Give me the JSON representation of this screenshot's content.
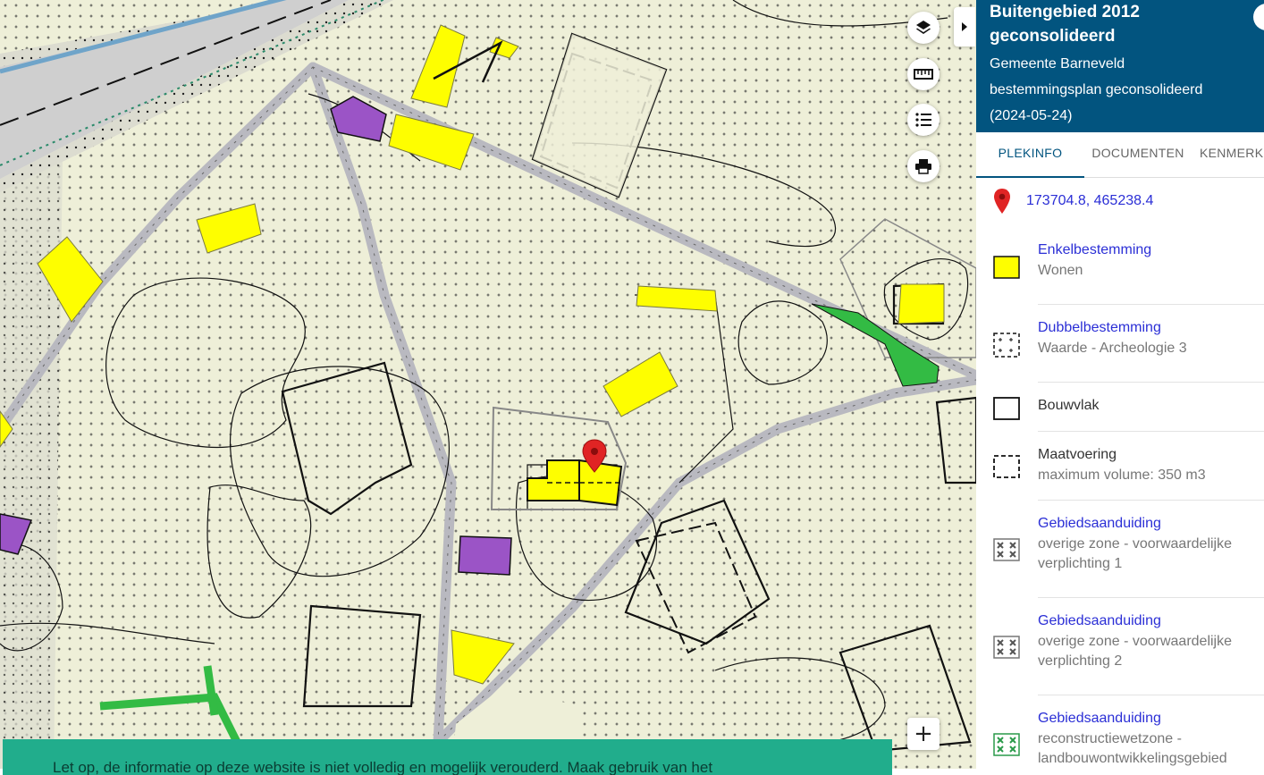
{
  "map": {
    "marker_icon": "map-marker-icon",
    "controls": [
      {
        "name": "layers",
        "icon": "layers-icon"
      },
      {
        "name": "measure",
        "icon": "ruler-icon"
      },
      {
        "name": "legend",
        "icon": "list-icon"
      },
      {
        "name": "print",
        "icon": "printer-icon"
      }
    ],
    "zoom_in_label": "+",
    "collapse_icon": "caret-right-icon"
  },
  "banner": {
    "text": "Let op, de informatie op deze website is niet volledig en mogelijk verouderd. Maak gebruik van het"
  },
  "panel": {
    "title": "Buitengebied 2012 geconsolideerd",
    "subtitle": "Gemeente Barneveld bestemmingsplan geconsolideerd (2024-05-24)",
    "header_color": "#02547f",
    "tabs": [
      {
        "label": "PLEKINFO",
        "active": true
      },
      {
        "label": "DOCUMENTEN",
        "active": false
      },
      {
        "label": "KENMERKEN",
        "active": false
      }
    ],
    "coordinates": "173704.8, 465238.4",
    "coordinates_icon": "map-pin-icon",
    "legend": [
      {
        "title": "Enkelbestemming",
        "desc": "Wonen",
        "symbol": "yellow-fill-icon"
      },
      {
        "title": "Dubbelbestemming",
        "desc": "Waarde - Archeologie 3",
        "symbol": "archeology-pattern-icon"
      },
      {
        "title": "Bouwvlak",
        "desc": "",
        "symbol": "solid-outline-icon"
      },
      {
        "title": "Maatvoering",
        "desc": "maximum volume: 350 m3",
        "symbol": "dashed-outline-icon"
      },
      {
        "title": "Gebiedsaanduiding",
        "desc": "overige zone - voorwaardelijke verplichting 1",
        "symbol": "zone-pattern-icon"
      },
      {
        "title": "Gebiedsaanduiding",
        "desc": "overige zone - voorwaardelijke verplichting 2",
        "symbol": "zone-pattern-icon"
      },
      {
        "title": "Gebiedsaanduiding",
        "desc": "reconstructiewetzone - landbouwontwikkelingsgebied",
        "symbol": "zone-pattern-green-icon"
      }
    ]
  }
}
